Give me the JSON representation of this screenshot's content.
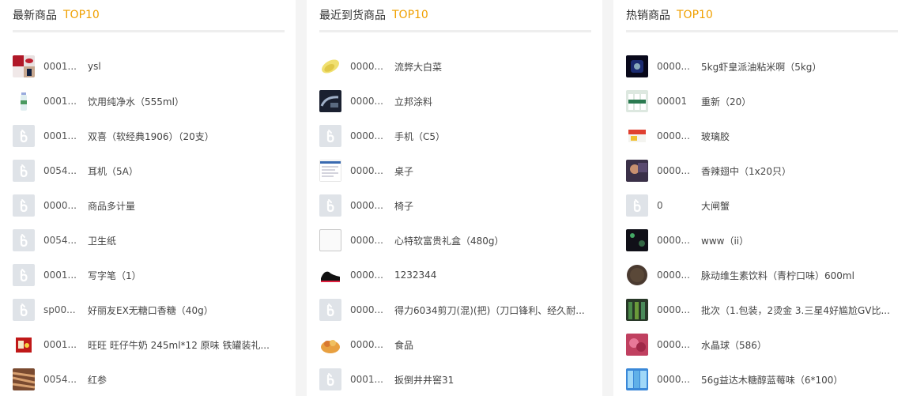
{
  "panels": [
    {
      "title": "最新商品",
      "badge": "TOP10",
      "items": [
        {
          "code": "0001...",
          "name": "ysl",
          "thumb": "lipstick"
        },
        {
          "code": "0001...",
          "name": "饮用纯净水（555ml）",
          "thumb": "water"
        },
        {
          "code": "0001...",
          "name": "双喜（软经典1906）（20支）",
          "thumb": "placeholder"
        },
        {
          "code": "0054...",
          "name": "耳机（5A）",
          "thumb": "placeholder"
        },
        {
          "code": "0000...",
          "name": "商品多计量",
          "thumb": "placeholder"
        },
        {
          "code": "0054...",
          "name": "卫生纸",
          "thumb": "placeholder"
        },
        {
          "code": "0001...",
          "name": "写字笔（1）",
          "thumb": "placeholder"
        },
        {
          "code": "sp00...",
          "name": "好丽友EX无糖口香糖（40g）",
          "thumb": "placeholder"
        },
        {
          "code": "0001...",
          "name": "旺旺 旺仔牛奶 245ml*12 原味 铁罐装礼...",
          "thumb": "milk"
        },
        {
          "code": "0054...",
          "name": "红参",
          "thumb": "ginseng"
        }
      ]
    },
    {
      "title": "最近到货商品",
      "badge": "TOP10",
      "items": [
        {
          "code": "0000...",
          "name": "流弊大白菜",
          "thumb": "cabbage"
        },
        {
          "code": "0000...",
          "name": "立邦涂料",
          "thumb": "car"
        },
        {
          "code": "0000...",
          "name": "手机（C5）",
          "thumb": "placeholder"
        },
        {
          "code": "0000...",
          "name": "桌子",
          "thumb": "screen"
        },
        {
          "code": "0000...",
          "name": "椅子",
          "thumb": "placeholder"
        },
        {
          "code": "0000...",
          "name": "心特软富贵礼盒（480g）",
          "thumb": "broken"
        },
        {
          "code": "0000...",
          "name": "1232344",
          "thumb": "shoe"
        },
        {
          "code": "0000...",
          "name": "得力6034剪刀(混)(把)（刀口锋利、经久耐...",
          "thumb": "placeholder"
        },
        {
          "code": "0000...",
          "name": "食品",
          "thumb": "food"
        },
        {
          "code": "0001...",
          "name": "扳倒井井窖31",
          "thumb": "placeholder"
        }
      ]
    },
    {
      "title": "热销商品",
      "badge": "TOP10",
      "items": [
        {
          "code": "0000...",
          "name": "5kg虾皇派油粘米啊（5kg）",
          "thumb": "dark"
        },
        {
          "code": "00001",
          "name": "重新（20）",
          "thumb": "bottles"
        },
        {
          "code": "0000...",
          "name": "玻璃胶",
          "thumb": "box"
        },
        {
          "code": "0000...",
          "name": "香辣翅中（1x20只）",
          "thumb": "photo"
        },
        {
          "code": "0",
          "name": "大闸蟹",
          "thumb": "placeholder"
        },
        {
          "code": "0000...",
          "name": "www（ii）",
          "thumb": "night"
        },
        {
          "code": "0000...",
          "name": "脉动维生素饮料（青柠口味）600ml",
          "thumb": "round"
        },
        {
          "code": "0000...",
          "name": "批次（1.包装，2烫金 3.三星4好尴尬GV比...",
          "thumb": "bottles2"
        },
        {
          "code": "0000...",
          "name": "水晶球（586）",
          "thumb": "pink"
        },
        {
          "code": "0000...",
          "name": "56g益达木糖醇蓝莓味（6*100）",
          "thumb": "blue"
        }
      ]
    }
  ]
}
